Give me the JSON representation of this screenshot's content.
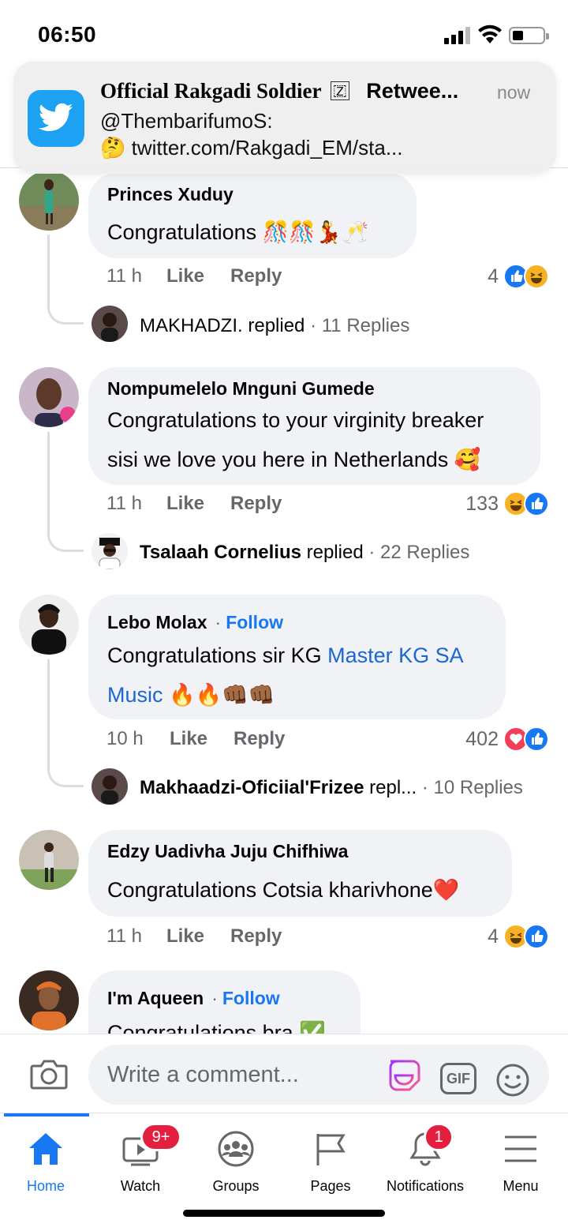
{
  "status_bar": {
    "time": "06:50"
  },
  "notification": {
    "sender_name": "Official Rakgadi Soldier",
    "sender_badge": "🇿",
    "action": "Retwee...",
    "time": "now",
    "line1": "@ThembarifumoS:",
    "line2": "🤔 twitter.com/Rakgadi_EM/sta...",
    "app_icon": "twitter-bird-icon",
    "accent": "#1da1f2"
  },
  "comments": [
    {
      "author": "Princes Xuduy",
      "text_lines": [
        "Congratulations 🎊🎊💃🥂"
      ],
      "time": "11 h",
      "like": "Like",
      "reply": "Reply",
      "reaction_count": "4",
      "reactions": [
        "like",
        "haha"
      ],
      "reply_preview": {
        "name": "MAKHADZI.",
        "verb": " replied",
        "count": " · 11 Replies"
      }
    },
    {
      "author": "Nompumelelo Mnguni Gumede",
      "text_lines": [
        "Congratulations to your virginity breaker",
        "sisi we love you here in Netherlands 🥰"
      ],
      "time": "11 h",
      "like": "Like",
      "reply": "Reply",
      "reaction_count": "133",
      "reactions": [
        "haha",
        "like"
      ],
      "reply_preview": {
        "name": "Tsalaah Cornelius",
        "verb": " replied",
        "count": " · 22 Replies"
      }
    },
    {
      "author": "Lebo Molax",
      "follow": "Follow",
      "text_plain": "Congratulations sir KG ",
      "text_link1": "Master KG SA",
      "text_link2": "Music",
      "text_emojis": " 🔥🔥👊🏾👊🏾",
      "time": "10 h",
      "like": "Like",
      "reply": "Reply",
      "reaction_count": "402",
      "reactions": [
        "love",
        "like"
      ],
      "reply_preview": {
        "name": "Makhaadzi-Oficiial'Frizee",
        "verb": " repl...",
        "count": " · 10 Replies"
      }
    },
    {
      "author": "Edzy Uadivha Juju Chifhiwa",
      "text_lines": [
        "Congratulations Cotsia kharivhone❤️"
      ],
      "time": "11 h",
      "like": "Like",
      "reply": "Reply",
      "reaction_count": "4",
      "reactions": [
        "haha",
        "like"
      ]
    },
    {
      "author": "I'm Aqueen",
      "follow": "Follow",
      "text_lines": [
        "Congratulations bra ✅"
      ]
    }
  ],
  "composer": {
    "placeholder": "Write a comment...",
    "gif_label": "GIF"
  },
  "tabbar": {
    "tabs": [
      {
        "label": "Home",
        "icon": "home-icon"
      },
      {
        "label": "Watch",
        "icon": "watch-icon",
        "badge": "9+"
      },
      {
        "label": "Groups",
        "icon": "groups-icon"
      },
      {
        "label": "Pages",
        "icon": "pages-flag-icon"
      },
      {
        "label": "Notifications",
        "icon": "bell-icon",
        "badge": "1"
      },
      {
        "label": "Menu",
        "icon": "menu-icon"
      }
    ],
    "active_color": "#1877f2"
  }
}
